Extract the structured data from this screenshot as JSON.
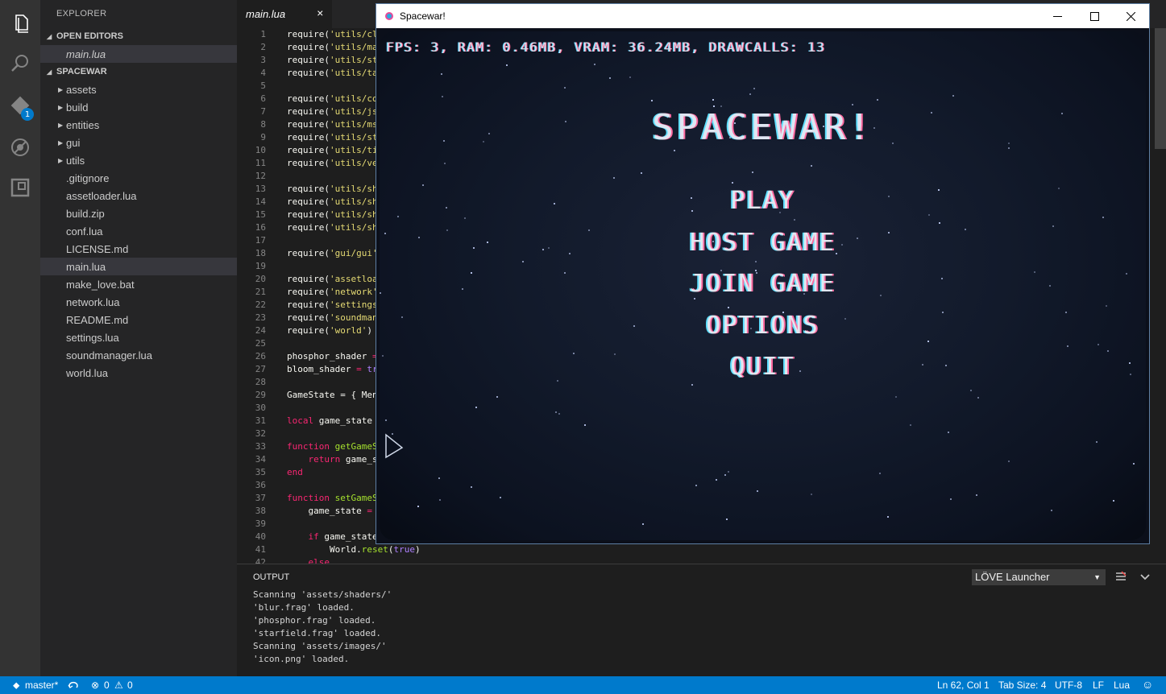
{
  "explorer": {
    "title": "EXPLORER",
    "open_editors_label": "OPEN EDITORS",
    "open_editor_file": "main.lua",
    "project_label": "SPACEWAR",
    "folders": [
      "assets",
      "build",
      "entities",
      "gui",
      "utils"
    ],
    "files": [
      ".gitignore",
      "assetloader.lua",
      "build.zip",
      "conf.lua",
      "LICENSE.md",
      "main.lua",
      "make_love.bat",
      "network.lua",
      "README.md",
      "settings.lua",
      "soundmanager.lua",
      "world.lua"
    ],
    "selected_file": "main.lua"
  },
  "activity_bar": {
    "icons": [
      "files-icon",
      "search-icon",
      "git-icon",
      "debug-icon",
      "extensions-icon"
    ],
    "git_badge": "1"
  },
  "editor": {
    "tab_label": "main.lua",
    "tab_close": "×",
    "line_numbers": [
      "1",
      "2",
      "3",
      "4",
      "5",
      "6",
      "7",
      "8",
      "9",
      "10",
      "11",
      "12",
      "13",
      "14",
      "15",
      "16",
      "17",
      "18",
      "19",
      "20",
      "21",
      "22",
      "23",
      "24",
      "25",
      "26",
      "27",
      "28",
      "29",
      "30",
      "31",
      "32",
      "33",
      "34",
      "35",
      "36",
      "37",
      "38",
      "39",
      "40",
      "41",
      "42"
    ]
  },
  "game_window": {
    "title": "Spacewar!",
    "hud": "FPS: 3, RAM: 0.46MB, VRAM: 36.24MB, DRAWCALLS: 13",
    "game_title": "SPACEWAR!",
    "menu": [
      "PLAY",
      "HOST GAME",
      "JOIN GAME",
      "OPTIONS",
      "QUIT"
    ]
  },
  "panel": {
    "title": "OUTPUT",
    "selector": "LÖVE Launcher",
    "lines": [
      "Scanning 'assets/shaders/'",
      "'blur.frag' loaded.",
      "'phosphor.frag' loaded.",
      "'starfield.frag' loaded.",
      "Scanning 'assets/images/'",
      "'icon.png' loaded."
    ]
  },
  "status_bar": {
    "branch": "master*",
    "errors": "0",
    "warnings": "0",
    "position": "Ln 62, Col 1",
    "tab_size": "Tab Size: 4",
    "encoding": "UTF-8",
    "eol": "LF",
    "language": "Lua"
  },
  "colors": {
    "accent": "#007acc",
    "activity_bar": "#333333",
    "sidebar": "#252526",
    "editor_bg": "#1e1e1e",
    "keyword": "#f92672",
    "function": "#a6e22e",
    "string": "#e6db74"
  }
}
